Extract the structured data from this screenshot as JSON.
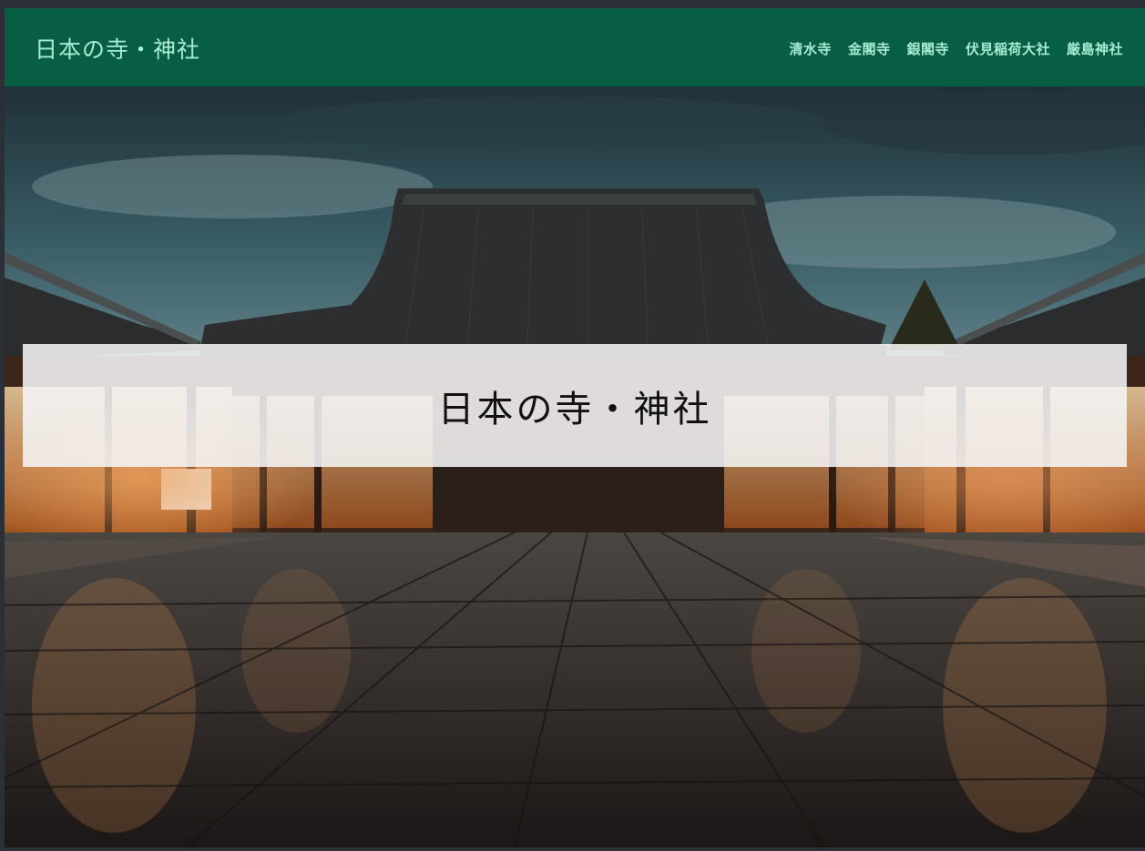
{
  "navbar": {
    "brand": "日本の寺・神社",
    "links": [
      "清水寺",
      "金閣寺",
      "銀閣寺",
      "伏見稲荷大社",
      "厳島神社"
    ]
  },
  "hero": {
    "title": "日本の寺・神社",
    "image_subject": "temple-courtyard-at-dusk"
  },
  "colors": {
    "navbar_bg": "#075e45",
    "nav_text": "#a7ecd2"
  }
}
